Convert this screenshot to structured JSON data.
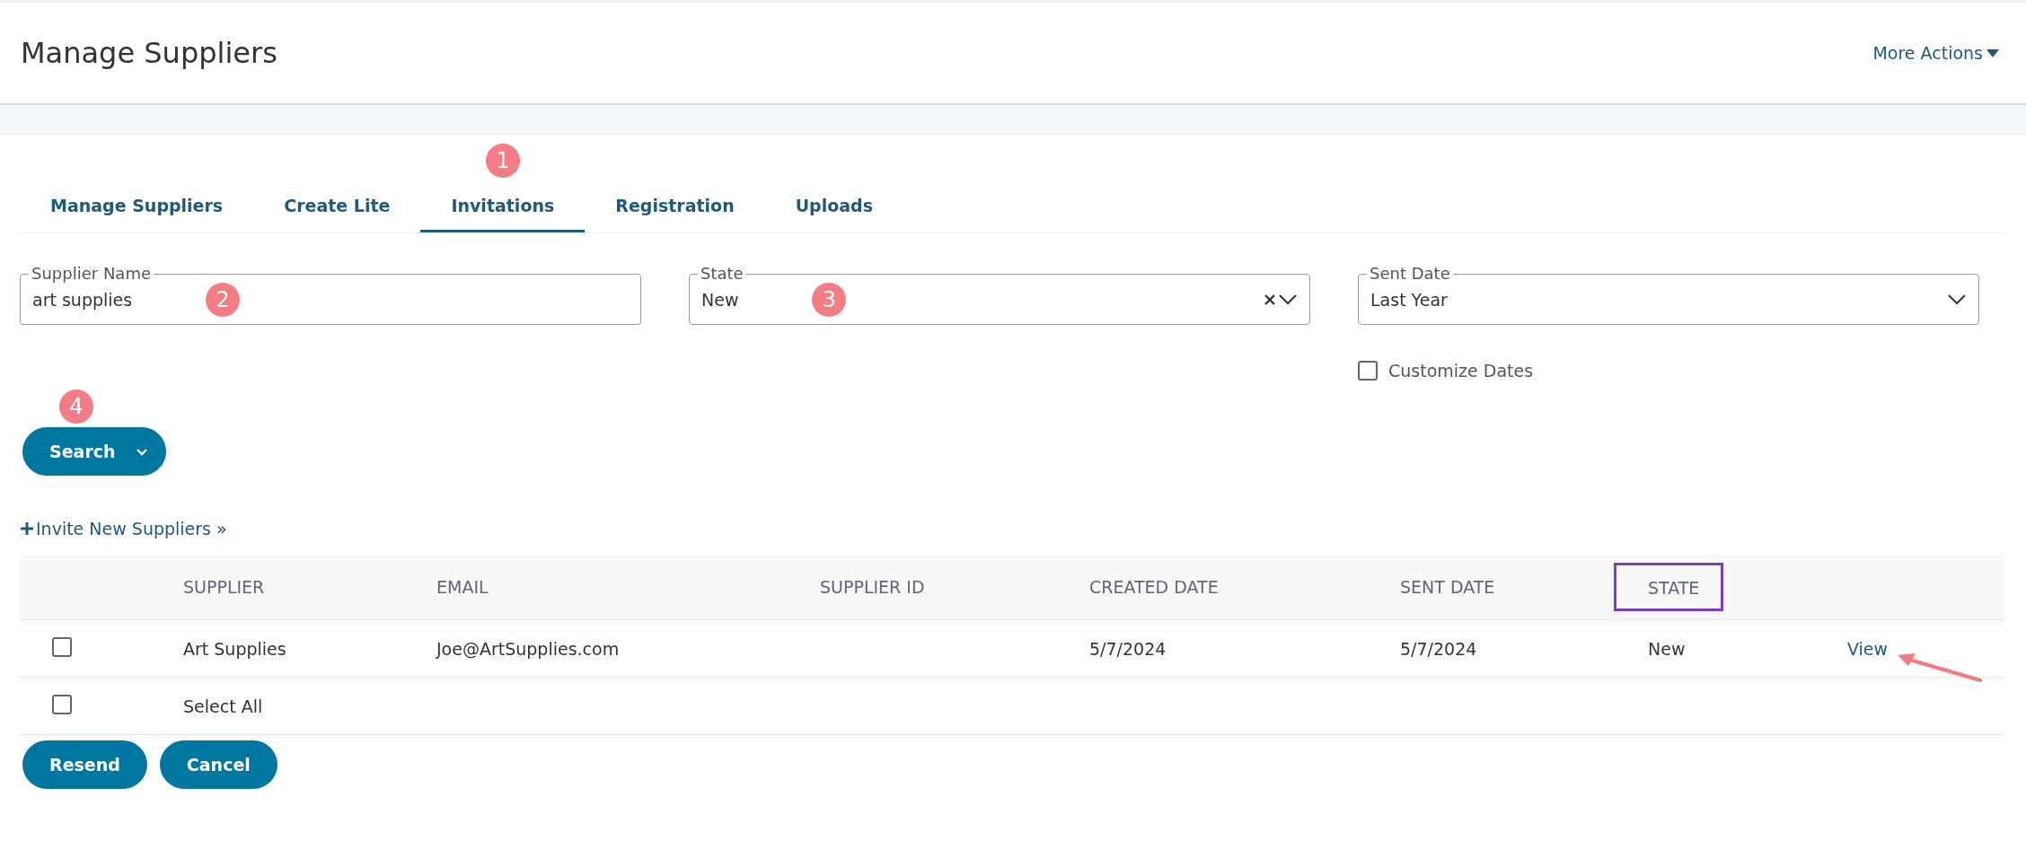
{
  "page": {
    "title": "Manage Suppliers",
    "more_actions": "More Actions"
  },
  "tabs": [
    {
      "label": "Manage Suppliers",
      "selected": false
    },
    {
      "label": "Create Lite",
      "selected": false
    },
    {
      "label": "Invitations",
      "selected": true,
      "callout": "1"
    },
    {
      "label": "Registration",
      "selected": false
    },
    {
      "label": "Uploads",
      "selected": false
    }
  ],
  "filters": [
    {
      "kind": "text",
      "label": "Supplier Name",
      "value": "art supplies",
      "callout": "2"
    },
    {
      "kind": "select",
      "label": "State",
      "value": "New",
      "clearable": true,
      "callout": "3"
    },
    {
      "kind": "select",
      "label": "Sent Date",
      "value": "Last Year",
      "clearable": false
    }
  ],
  "customize_dates": {
    "label": "Customize Dates",
    "checked": false
  },
  "search_button": {
    "label": "Search",
    "callout": "4"
  },
  "invite_link": "Invite New Suppliers »",
  "table": {
    "columns": [
      {
        "label": "SUPPLIER",
        "highlighted": false
      },
      {
        "label": "EMAIL",
        "highlighted": false
      },
      {
        "label": "SUPPLIER ID",
        "highlighted": false
      },
      {
        "label": "CREATED DATE",
        "highlighted": false
      },
      {
        "label": "SENT DATE",
        "highlighted": false
      },
      {
        "label": "STATE",
        "highlighted": true
      }
    ],
    "rows": [
      {
        "checked": false,
        "cells": [
          "Art Supplies",
          "Joe@ArtSupplies.com",
          "",
          "5/7/2024",
          "5/7/2024",
          "New"
        ],
        "action": "View",
        "arrow": true
      }
    ],
    "select_all": {
      "label": "Select All",
      "checked": false
    }
  },
  "buttons": [
    "Resend",
    "Cancel"
  ]
}
